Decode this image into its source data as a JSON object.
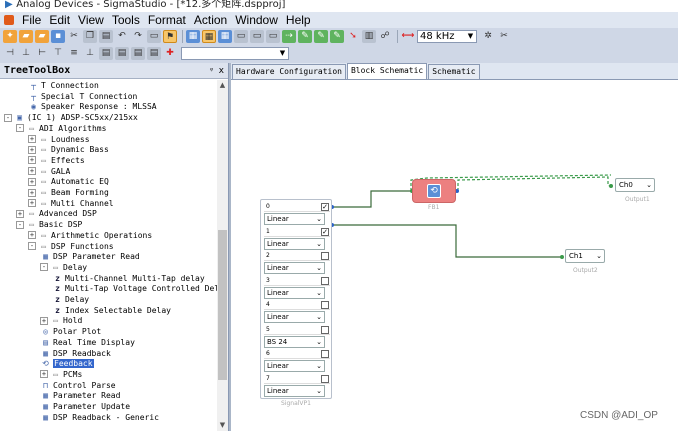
{
  "window": {
    "title": "Analog Devices - SigmaStudio - [*12.多个矩阵.dspproj]"
  },
  "menu": [
    "File",
    "Edit",
    "View",
    "Tools",
    "Format",
    "Action",
    "Window",
    "Help"
  ],
  "toolbar": {
    "sample_rate": "48 kHz"
  },
  "toolbox": {
    "title": "TreeToolBox",
    "pin_label": "ᵠ",
    "close_label": "x",
    "items": [
      {
        "label": "T Connection",
        "depth": 2,
        "icon": "t-connection-icon",
        "expander": ""
      },
      {
        "label": "Special T Connection",
        "depth": 2,
        "icon": "t-connection-icon",
        "expander": ""
      },
      {
        "label": "Speaker Response : MLSSA",
        "depth": 2,
        "icon": "speaker-icon",
        "expander": ""
      },
      {
        "label": "(IC 1) ADSP-SC5xx/215xx",
        "depth": 0,
        "icon": "chip-icon",
        "expander": "-"
      },
      {
        "label": "ADI Algorithms",
        "depth": 1,
        "icon": "folder-icon",
        "expander": "-"
      },
      {
        "label": "Loudness",
        "depth": 2,
        "icon": "folder-icon",
        "expander": "+"
      },
      {
        "label": "Dynamic Bass",
        "depth": 2,
        "icon": "folder-icon",
        "expander": "+"
      },
      {
        "label": "Effects",
        "depth": 2,
        "icon": "folder-icon",
        "expander": "+"
      },
      {
        "label": "GALA",
        "depth": 2,
        "icon": "folder-icon",
        "expander": "+"
      },
      {
        "label": "Automatic EQ",
        "depth": 2,
        "icon": "folder-icon",
        "expander": "+"
      },
      {
        "label": "Beam Forming",
        "depth": 2,
        "icon": "folder-icon",
        "expander": "+"
      },
      {
        "label": "Multi Channel",
        "depth": 2,
        "icon": "folder-icon",
        "expander": "+"
      },
      {
        "label": "Advanced DSP",
        "depth": 1,
        "icon": "folder-icon",
        "expander": "+"
      },
      {
        "label": "Basic DSP",
        "depth": 1,
        "icon": "folder-icon",
        "expander": "-"
      },
      {
        "label": "Arithmetic Operations",
        "depth": 2,
        "icon": "folder-icon",
        "expander": "+"
      },
      {
        "label": "DSP Functions",
        "depth": 2,
        "icon": "folder-icon",
        "expander": "-"
      },
      {
        "label": "DSP Parameter Read",
        "depth": 3,
        "icon": "block-icon",
        "expander": ""
      },
      {
        "label": "Delay",
        "depth": 3,
        "icon": "folder-icon",
        "expander": "-"
      },
      {
        "label": "Multi-Channel Multi-Tap delay",
        "depth": 4,
        "icon": "z-delay-icon",
        "expander": ""
      },
      {
        "label": "Multi-Tap Voltage Controlled Del",
        "depth": 4,
        "icon": "z-delay-icon",
        "expander": ""
      },
      {
        "label": "Delay",
        "depth": 4,
        "icon": "z-delay-icon",
        "expander": ""
      },
      {
        "label": "Index Selectable Delay",
        "depth": 4,
        "icon": "z-delay-icon",
        "expander": ""
      },
      {
        "label": "Hold",
        "depth": 3,
        "icon": "folder-icon",
        "expander": "+"
      },
      {
        "label": "Polar Plot",
        "depth": 3,
        "icon": "polar-icon",
        "expander": ""
      },
      {
        "label": "Real Time Display",
        "depth": 3,
        "icon": "display-icon",
        "expander": ""
      },
      {
        "label": "DSP Readback",
        "depth": 3,
        "icon": "block-icon",
        "expander": ""
      },
      {
        "label": "Feedback",
        "depth": 3,
        "icon": "feedback-icon",
        "expander": "",
        "selected": true
      },
      {
        "label": "PCMs",
        "depth": 3,
        "icon": "folder-icon",
        "expander": "+"
      },
      {
        "label": "Control Parse",
        "depth": 3,
        "icon": "parse-icon",
        "expander": ""
      },
      {
        "label": "Parameter Read",
        "depth": 3,
        "icon": "block-icon",
        "expander": ""
      },
      {
        "label": "Parameter Update",
        "depth": 3,
        "icon": "block-icon",
        "expander": ""
      },
      {
        "label": "DSP Readback - Generic",
        "depth": 3,
        "icon": "block-icon",
        "expander": ""
      }
    ]
  },
  "tabs": [
    "Hardware Configuration",
    "Block Schematic",
    "Schematic"
  ],
  "active_tab": 1,
  "schematic": {
    "feedback_block": {
      "caption": "FB1"
    },
    "output1": {
      "channel": "Ch0",
      "caption": "Output1"
    },
    "output2": {
      "channel": "Ch1",
      "caption": "Output2"
    },
    "signal_block": {
      "caption": "SignalVP1",
      "rows": [
        {
          "index": "0",
          "checked": true,
          "mode": "Linear"
        },
        {
          "index": "1",
          "checked": true,
          "mode": "Linear"
        },
        {
          "index": "2",
          "checked": false,
          "mode": "Linear"
        },
        {
          "index": "3",
          "checked": false,
          "mode": "Linear"
        },
        {
          "index": "4",
          "checked": false,
          "mode": "Linear"
        },
        {
          "index": "5",
          "checked": false,
          "mode": "BS 24"
        },
        {
          "index": "6",
          "checked": false,
          "mode": "Linear"
        },
        {
          "index": "7",
          "checked": false,
          "mode": "Linear"
        }
      ]
    }
  },
  "watermark": "CSDN @ADI_OP"
}
